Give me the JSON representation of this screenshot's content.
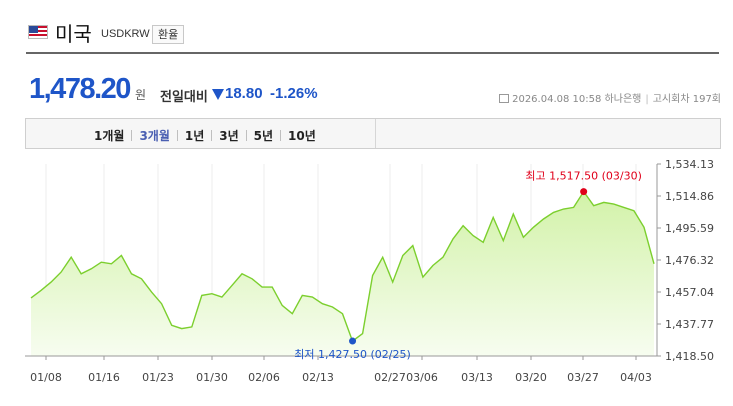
{
  "header": {
    "country": "미국",
    "code": "USDKRW",
    "exchange_button": "환율"
  },
  "quote": {
    "price": "1,478.20",
    "unit": "원",
    "compare_label": "전일대비",
    "change": "18.80",
    "change_pct": "-1.26%",
    "direction": "down",
    "color": "#1e55c8"
  },
  "meta": {
    "datetime": "2026.04.08 10:58",
    "bank": "하나은행",
    "round": "고시회차 197회"
  },
  "tabs": [
    {
      "label": "1개월",
      "active": false
    },
    {
      "label": "3개월",
      "active": true
    },
    {
      "label": "1년",
      "active": false
    },
    {
      "label": "3년",
      "active": false
    },
    {
      "label": "5년",
      "active": false
    },
    {
      "label": "10년",
      "active": false
    }
  ],
  "chart_data": {
    "type": "area",
    "line_color": "#7ccf2e",
    "fill_top_color": "#d2f2a8",
    "fill_bottom_color": "#f7fdf0",
    "grid": "vertical",
    "ylim": [
      1418.5,
      1534.13
    ],
    "y_ticks": [
      "1,534.13",
      "1,514.86",
      "1,495.59",
      "1,476.32",
      "1,457.04",
      "1,437.77",
      "1,418.50"
    ],
    "x_ticks": [
      "01/08",
      "01/16",
      "01/23",
      "01/30",
      "02/06",
      "02/13",
      "02/27",
      "03/06",
      "03/13",
      "03/20",
      "03/27",
      "04/03"
    ],
    "values": [
      1453.5,
      1458,
      1463,
      1469,
      1478,
      1468,
      1471,
      1475,
      1474,
      1479,
      1468,
      1465,
      1457,
      1450,
      1437,
      1435,
      1436,
      1455,
      1456,
      1454,
      1461,
      1468,
      1465,
      1460,
      1460,
      1449,
      1444,
      1455,
      1454,
      1450,
      1448,
      1444,
      1427.5,
      1432,
      1467,
      1478,
      1463,
      1479,
      1485,
      1466,
      1473,
      1478,
      1489,
      1497,
      1491,
      1487,
      1502,
      1488,
      1504,
      1490,
      1496,
      1501,
      1505,
      1507,
      1508,
      1517.5,
      1509,
      1511,
      1510,
      1508,
      1506,
      1496,
      1474
    ],
    "high": {
      "label": "최고 1,517.50 (03/30)",
      "value": 1517.5,
      "color": "#e0001a"
    },
    "low": {
      "label": "최저 1,427.50 (02/25)",
      "value": 1427.5,
      "color": "#1e55c8"
    }
  }
}
